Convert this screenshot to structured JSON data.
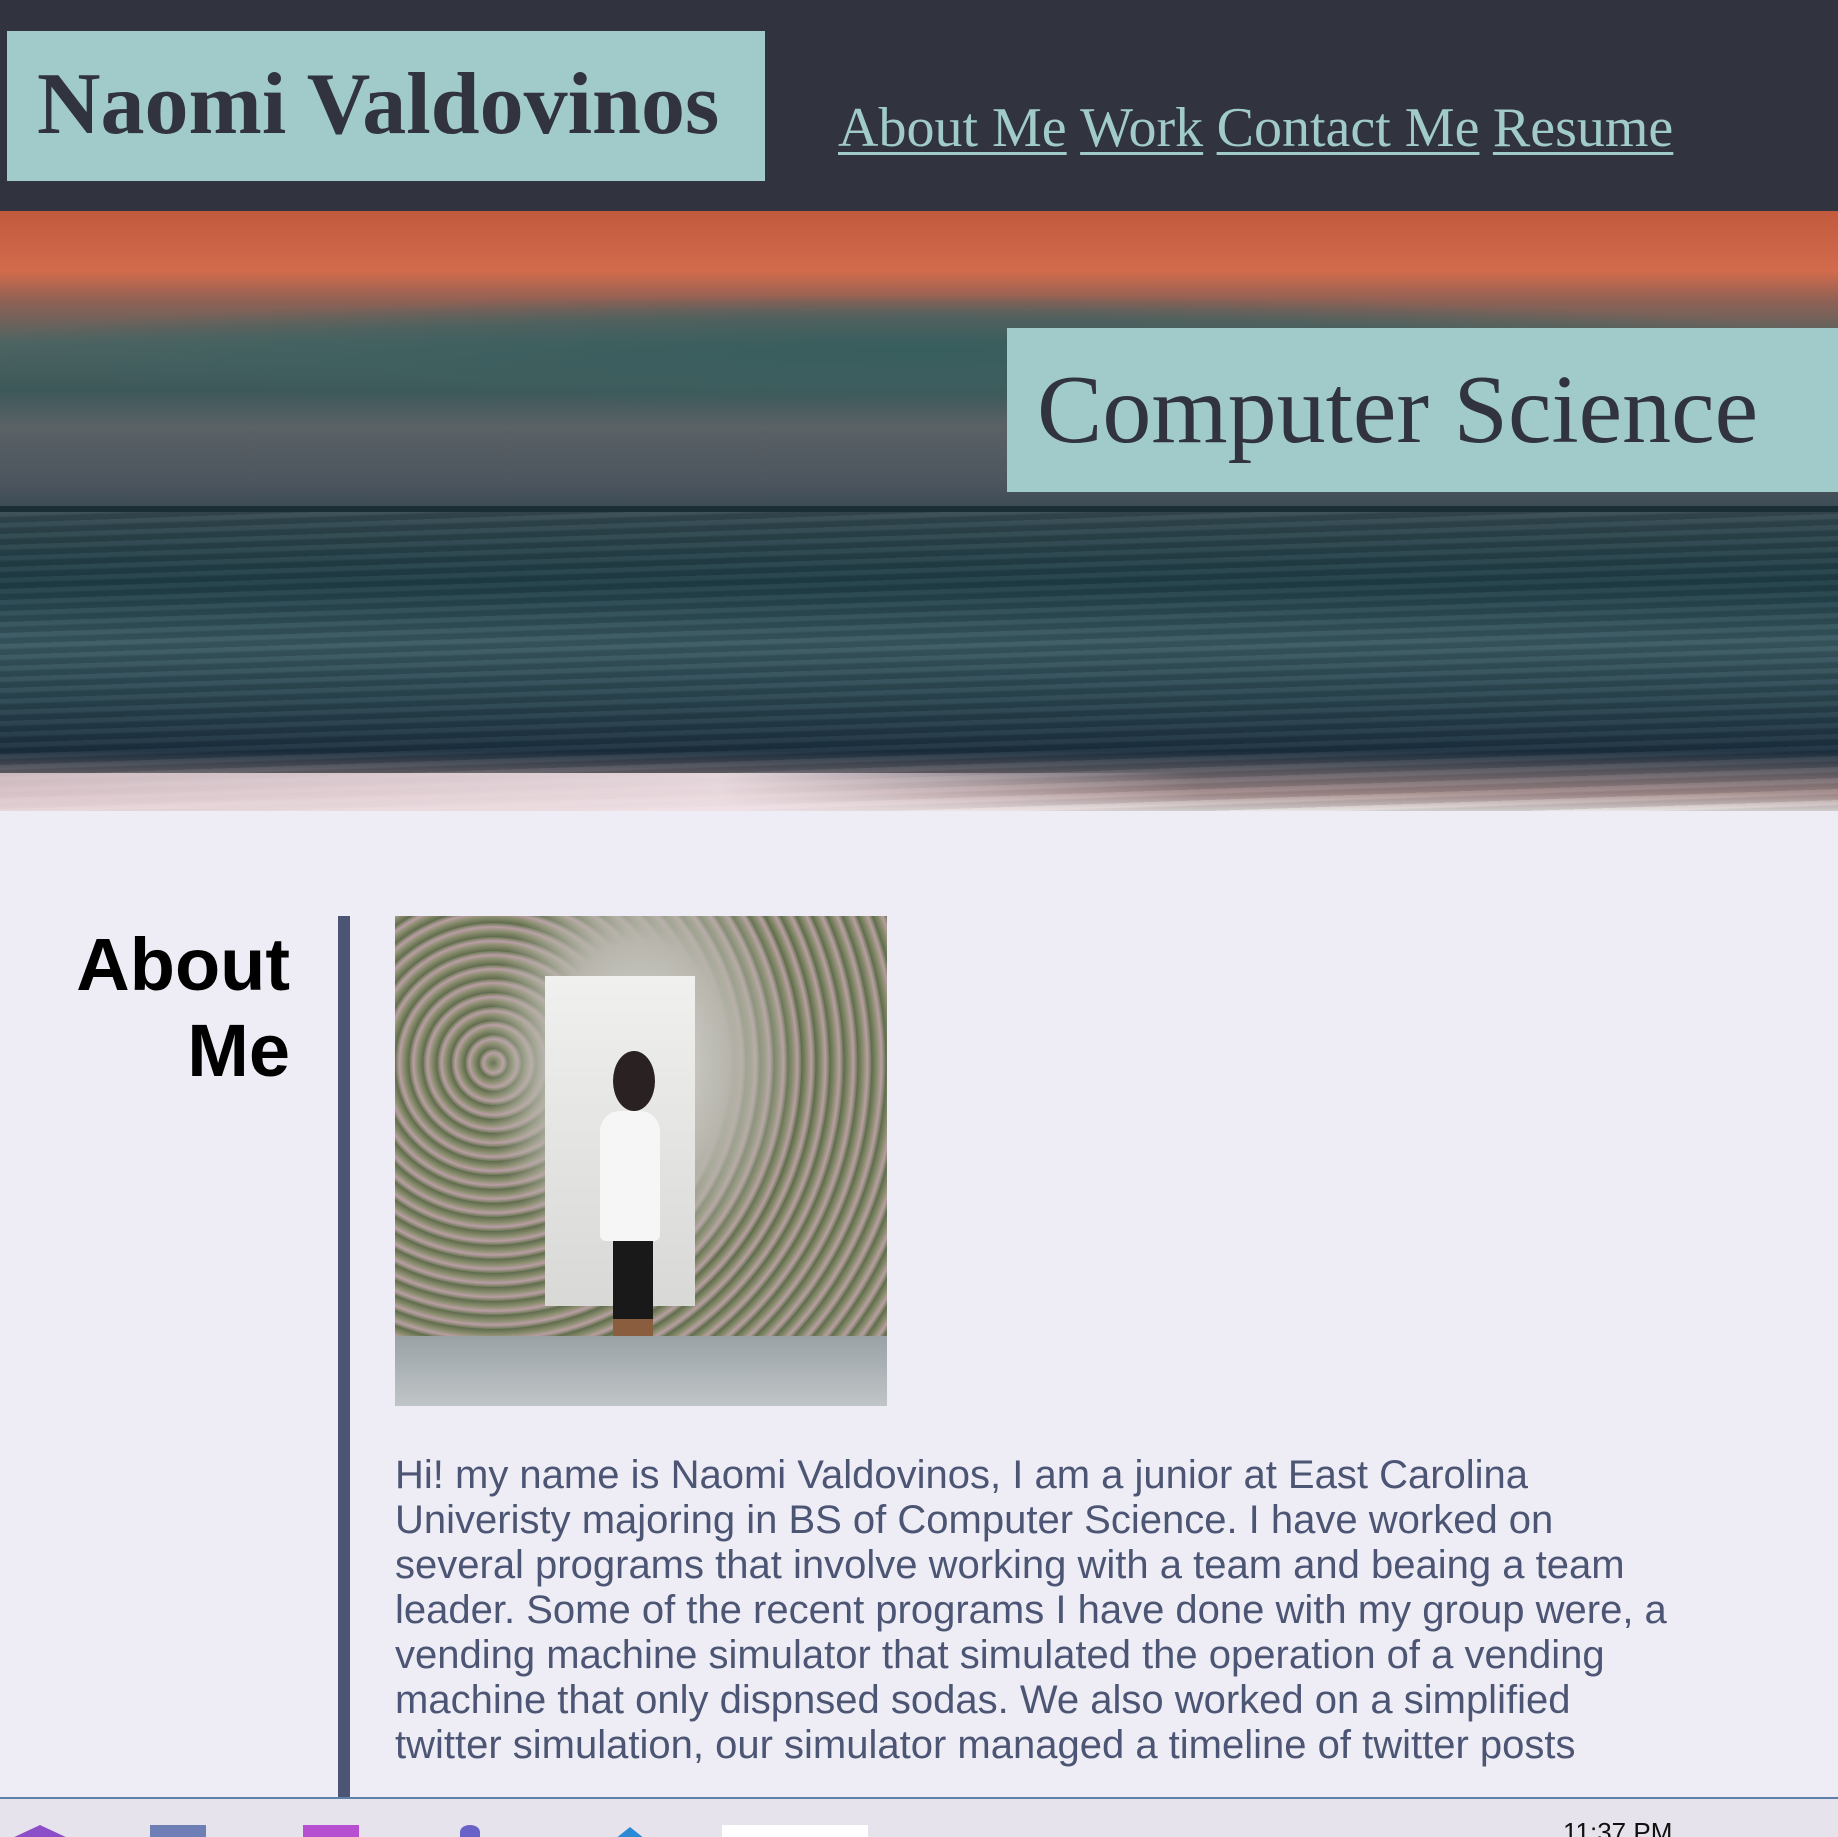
{
  "header": {
    "site_name": "Naomi Valdovinos",
    "nav": [
      {
        "label": "About Me"
      },
      {
        "label": "Work"
      },
      {
        "label": "Contact Me"
      },
      {
        "label": "Resume"
      }
    ]
  },
  "hero": {
    "subtitle": "Computer Science"
  },
  "about": {
    "heading_line1": "About",
    "heading_line2": "Me",
    "bio": "Hi! my name is Naomi Valdovinos, I am a junior at East Carolina Univeristy majoring in BS of Computer Science. I have worked on several programs that involve working with a team and beaing a team leader. Some of the recent programs I have done with my group were, a vending machine simulator that simulated the operation of a vending machine that only dispnsed sodas. We also worked on a simplified twitter simulation, our simulator managed a timeline of twitter posts"
  },
  "taskbar": {
    "clock": "11:37 PM"
  },
  "colors": {
    "header_bg": "#31333f",
    "accent_teal": "#a1cbca",
    "page_bg": "#eeedf5",
    "body_text": "#4c5674"
  }
}
